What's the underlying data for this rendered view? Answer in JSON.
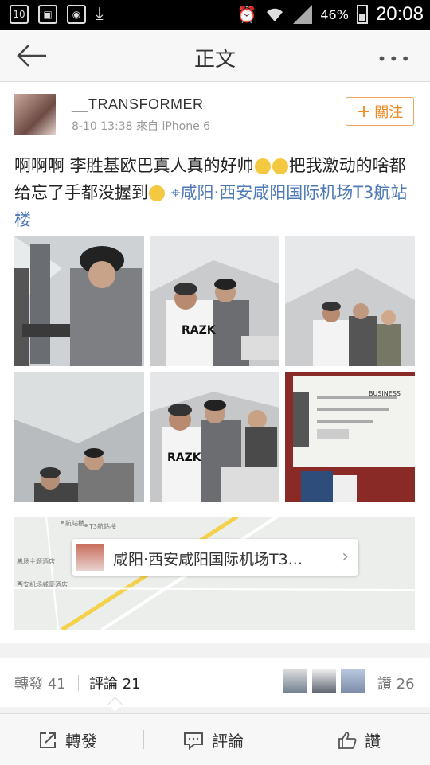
{
  "status_bar": {
    "notification_count": "10",
    "battery_text": "46%",
    "time": "20:08",
    "icons": [
      "calendar-icon",
      "gallery-icon",
      "instagram-icon",
      "download-icon",
      "alarm-icon",
      "wifi-icon",
      "signal-icon",
      "battery-icon"
    ]
  },
  "nav": {
    "title": "正文",
    "more_label": "•••"
  },
  "post": {
    "username": "__TRANSFORMER",
    "meta": "8-10 13:38  來自 iPhone 6",
    "follow_label": "關注",
    "follow_icon": "plus",
    "text_part1": "啊啊啊 李胜基欧巴真人真的好帅",
    "text_part2": "把我激动的啥都给忘了手都没握到",
    "location_text": "咸阳·西安咸阳国际机场T3航站楼",
    "emoji_name": "crying-face",
    "accent_color": "#f08a24",
    "link_color": "#4e7ab5"
  },
  "map": {
    "place_label": "咸阳·西安咸阳国际机场T3...",
    "poi_1": "航站楼",
    "poi_2": "T3航站楼",
    "poi_3": "机场主题酒店",
    "poi_4": "西安机场威豪酒店"
  },
  "stats": {
    "repost_label": "轉發 41",
    "comment_label": "評論 21",
    "like_label": "讚 26"
  },
  "bottom_bar": {
    "repost": "轉發",
    "comment": "評論",
    "like": "讚"
  }
}
